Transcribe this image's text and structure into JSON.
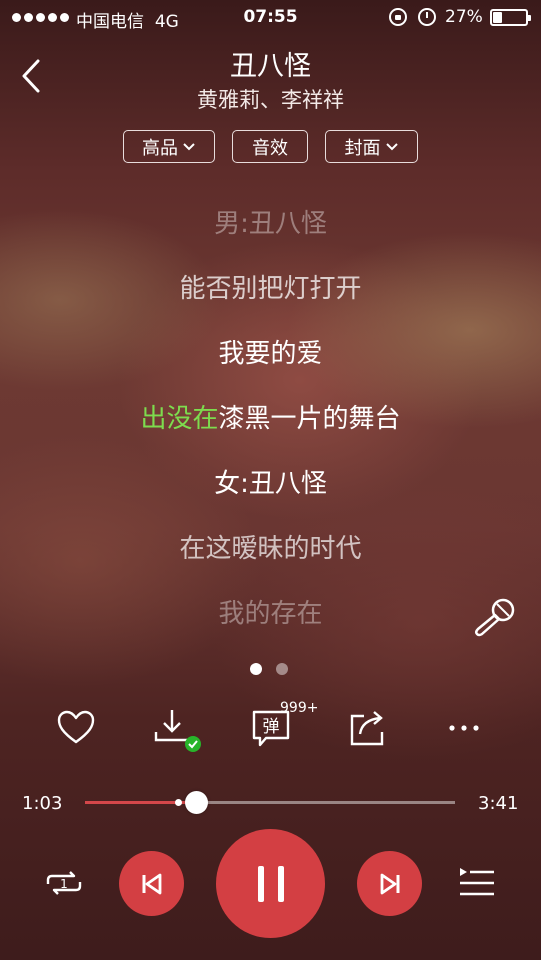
{
  "status_bar": {
    "carrier": "中国电信",
    "network": "4G",
    "time": "07:55",
    "battery_percent": "27%",
    "battery_level": 0.27
  },
  "header": {
    "song_title": "丑八怪",
    "artist": "黄雅莉、李祥祥"
  },
  "options": {
    "quality": "高品",
    "effects": "音效",
    "cover": "封面"
  },
  "lyrics": [
    {
      "text": "男:丑八怪",
      "highlight": "",
      "rest": ""
    },
    {
      "text": "能否别把灯打开",
      "highlight": "",
      "rest": ""
    },
    {
      "text": "我要的爱",
      "highlight": "",
      "rest": ""
    },
    {
      "text": "",
      "highlight": "出没在",
      "rest": "漆黑一片的舞台"
    },
    {
      "text": "女:丑八怪",
      "highlight": "",
      "rest": ""
    },
    {
      "text": "在这暧昧的时代",
      "highlight": "",
      "rest": ""
    },
    {
      "text": "我的存在",
      "highlight": "",
      "rest": ""
    }
  ],
  "pager": {
    "pages": 2,
    "current": 1
  },
  "actions": {
    "comment_count": "999+"
  },
  "progress": {
    "current_time": "1:03",
    "total_time": "3:41",
    "played_fraction": 0.3,
    "buffered_fraction": 0.25
  },
  "colors": {
    "accent": "#d33f43",
    "lyric_highlight": "#7ddc4e",
    "download_check": "#28b42a"
  },
  "icons": {
    "back": "chevron-left-icon",
    "like": "heart-icon",
    "download": "download-icon",
    "comments": "danmu-comment-icon",
    "share": "share-icon",
    "more": "more-dots-icon",
    "mic": "microphone-icon",
    "loop": "repeat-one-icon",
    "prev": "skip-previous-icon",
    "pause": "pause-icon",
    "next": "skip-next-icon",
    "queue": "playlist-icon"
  }
}
